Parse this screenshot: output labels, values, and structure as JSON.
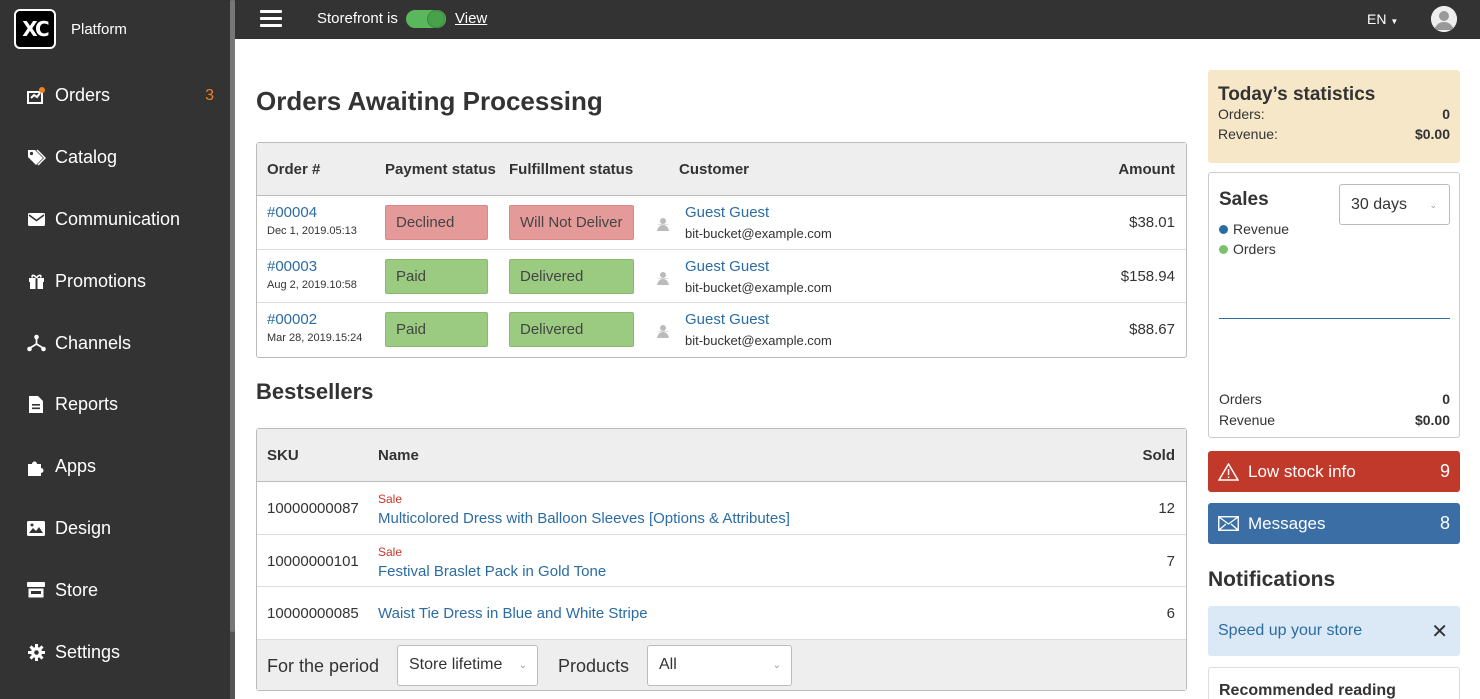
{
  "sidebar": {
    "logo_text": "XC",
    "platform": "Platform",
    "items": [
      {
        "label": "Orders",
        "icon": "orders-icon",
        "count": "3"
      },
      {
        "label": "Catalog",
        "icon": "tag-icon",
        "count": ""
      },
      {
        "label": "Communication",
        "icon": "envelope-icon",
        "count": ""
      },
      {
        "label": "Promotions",
        "icon": "gift-icon",
        "count": ""
      },
      {
        "label": "Channels",
        "icon": "channels-icon",
        "count": ""
      },
      {
        "label": "Reports",
        "icon": "report-icon",
        "count": ""
      },
      {
        "label": "Apps",
        "icon": "puzzle-icon",
        "count": ""
      },
      {
        "label": "Design",
        "icon": "image-icon",
        "count": ""
      },
      {
        "label": "Store",
        "icon": "store-icon",
        "count": ""
      },
      {
        "label": "Settings",
        "icon": "gear-icon",
        "count": ""
      }
    ]
  },
  "topbar": {
    "storefront_label": "Storefront is",
    "storefront_on": true,
    "view_label": "View",
    "language": "EN"
  },
  "orders": {
    "title": "Orders Awaiting Processing",
    "headers": {
      "order": "Order #",
      "payment": "Payment status",
      "fulfillment": "Fulfillment status",
      "customer": "Customer",
      "amount": "Amount"
    },
    "rows": [
      {
        "number": "#00004",
        "date": "Dec 1, 2019.05:13",
        "payment": "Declined",
        "fulfillment": "Will Not Deliver",
        "customer": "Guest Guest",
        "email": "bit-bucket@example.com",
        "amount": "$38.01"
      },
      {
        "number": "#00003",
        "date": "Aug 2, 2019.10:58",
        "payment": "Paid",
        "fulfillment": "Delivered",
        "customer": "Guest Guest",
        "email": "bit-bucket@example.com",
        "amount": "$158.94"
      },
      {
        "number": "#00002",
        "date": "Mar 28, 2019.15:24",
        "payment": "Paid",
        "fulfillment": "Delivered",
        "customer": "Guest Guest",
        "email": "bit-bucket@example.com",
        "amount": "$88.67"
      }
    ]
  },
  "bestsellers": {
    "title": "Bestsellers",
    "headers": {
      "sku": "SKU",
      "name": "Name",
      "sold": "Sold"
    },
    "rows": [
      {
        "sku": "10000000087",
        "sale": "Sale",
        "name": "Multicolored Dress with Balloon Sleeves [Options & Attributes]",
        "sold": "12"
      },
      {
        "sku": "10000000101",
        "sale": "Sale",
        "name": "Festival Braslet Pack in Gold Tone",
        "sold": "7"
      },
      {
        "sku": "10000000085",
        "sale": "",
        "name": "Waist Tie Dress in Blue and White Stripe",
        "sold": "6"
      }
    ],
    "footer": {
      "period_label": "For the period",
      "period_value": "Store lifetime",
      "products_label": "Products",
      "products_value": "All"
    }
  },
  "stats": {
    "title": "Today’s statistics",
    "orders_label": "Orders:",
    "orders_value": "0",
    "revenue_label": "Revenue:",
    "revenue_value": "$0.00"
  },
  "sales": {
    "title": "Sales",
    "range": "30 days",
    "legend_revenue": "Revenue",
    "legend_orders": "Orders",
    "orders_label": "Orders",
    "orders_value": "0",
    "revenue_label": "Revenue",
    "revenue_value": "$0.00",
    "colors": {
      "revenue": "#2b6ca3",
      "orders": "#7cbf6d"
    }
  },
  "alerts": {
    "low_stock_label": "Low stock info",
    "low_stock_count": "9",
    "messages_label": "Messages",
    "messages_count": "8"
  },
  "notifications": {
    "title": "Notifications",
    "speed_label": "Speed up your store",
    "recommended_label": "Recommended reading"
  }
}
